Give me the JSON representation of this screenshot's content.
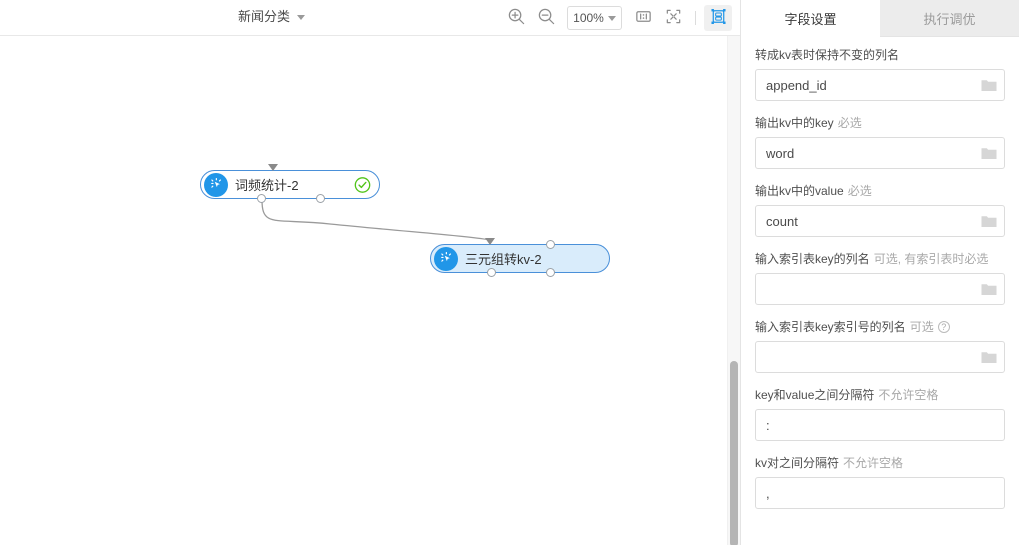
{
  "toolbar": {
    "doc_name": "新闻分类",
    "zoom_level": "100%",
    "buttons": {
      "zoom_in": "zoom-in",
      "zoom_out": "zoom-out",
      "fit_width": "fit-width",
      "fit_screen": "fit-screen",
      "select_mode": "select-mode"
    }
  },
  "canvas": {
    "nodes": [
      {
        "label": "词频统计-2",
        "status": "success"
      },
      {
        "label": "三元组转kv-2",
        "status": "selected"
      }
    ]
  },
  "panel": {
    "tabs": [
      {
        "label": "字段设置",
        "active": true
      },
      {
        "label": "执行调优",
        "active": false
      }
    ],
    "fields": [
      {
        "label": "转成kv表时保持不变的列名",
        "hint": "",
        "value": "append_id",
        "placeholder": "",
        "has_folder": true,
        "has_help": false
      },
      {
        "label": "输出kv中的key",
        "hint": "必选",
        "value": "word",
        "placeholder": "",
        "has_folder": true,
        "has_help": false
      },
      {
        "label": "输出kv中的value",
        "hint": "必选",
        "value": "count",
        "placeholder": "",
        "has_folder": true,
        "has_help": false
      },
      {
        "label": "输入索引表key的列名",
        "hint": "可选, 有索引表时必选",
        "value": "",
        "placeholder": "",
        "has_folder": true,
        "has_help": false
      },
      {
        "label": "输入索引表key索引号的列名",
        "hint": "可选",
        "value": "",
        "placeholder": "",
        "has_folder": true,
        "has_help": true,
        "help_glyph": "?"
      },
      {
        "label": "key和value之间分隔符",
        "hint": "不允许空格",
        "value": ":",
        "placeholder": "",
        "has_folder": false,
        "has_help": false
      },
      {
        "label": "kv对之间分隔符",
        "hint": "不允许空格",
        "value": ",",
        "placeholder": "",
        "has_folder": false,
        "has_help": false
      }
    ]
  },
  "colors": {
    "accent": "#2196e8",
    "node_border": "#4a90d9",
    "node_selected_fill": "#d9ecfb",
    "success": "#52c41a",
    "panel_tab_inactive_bg": "#ececec"
  }
}
